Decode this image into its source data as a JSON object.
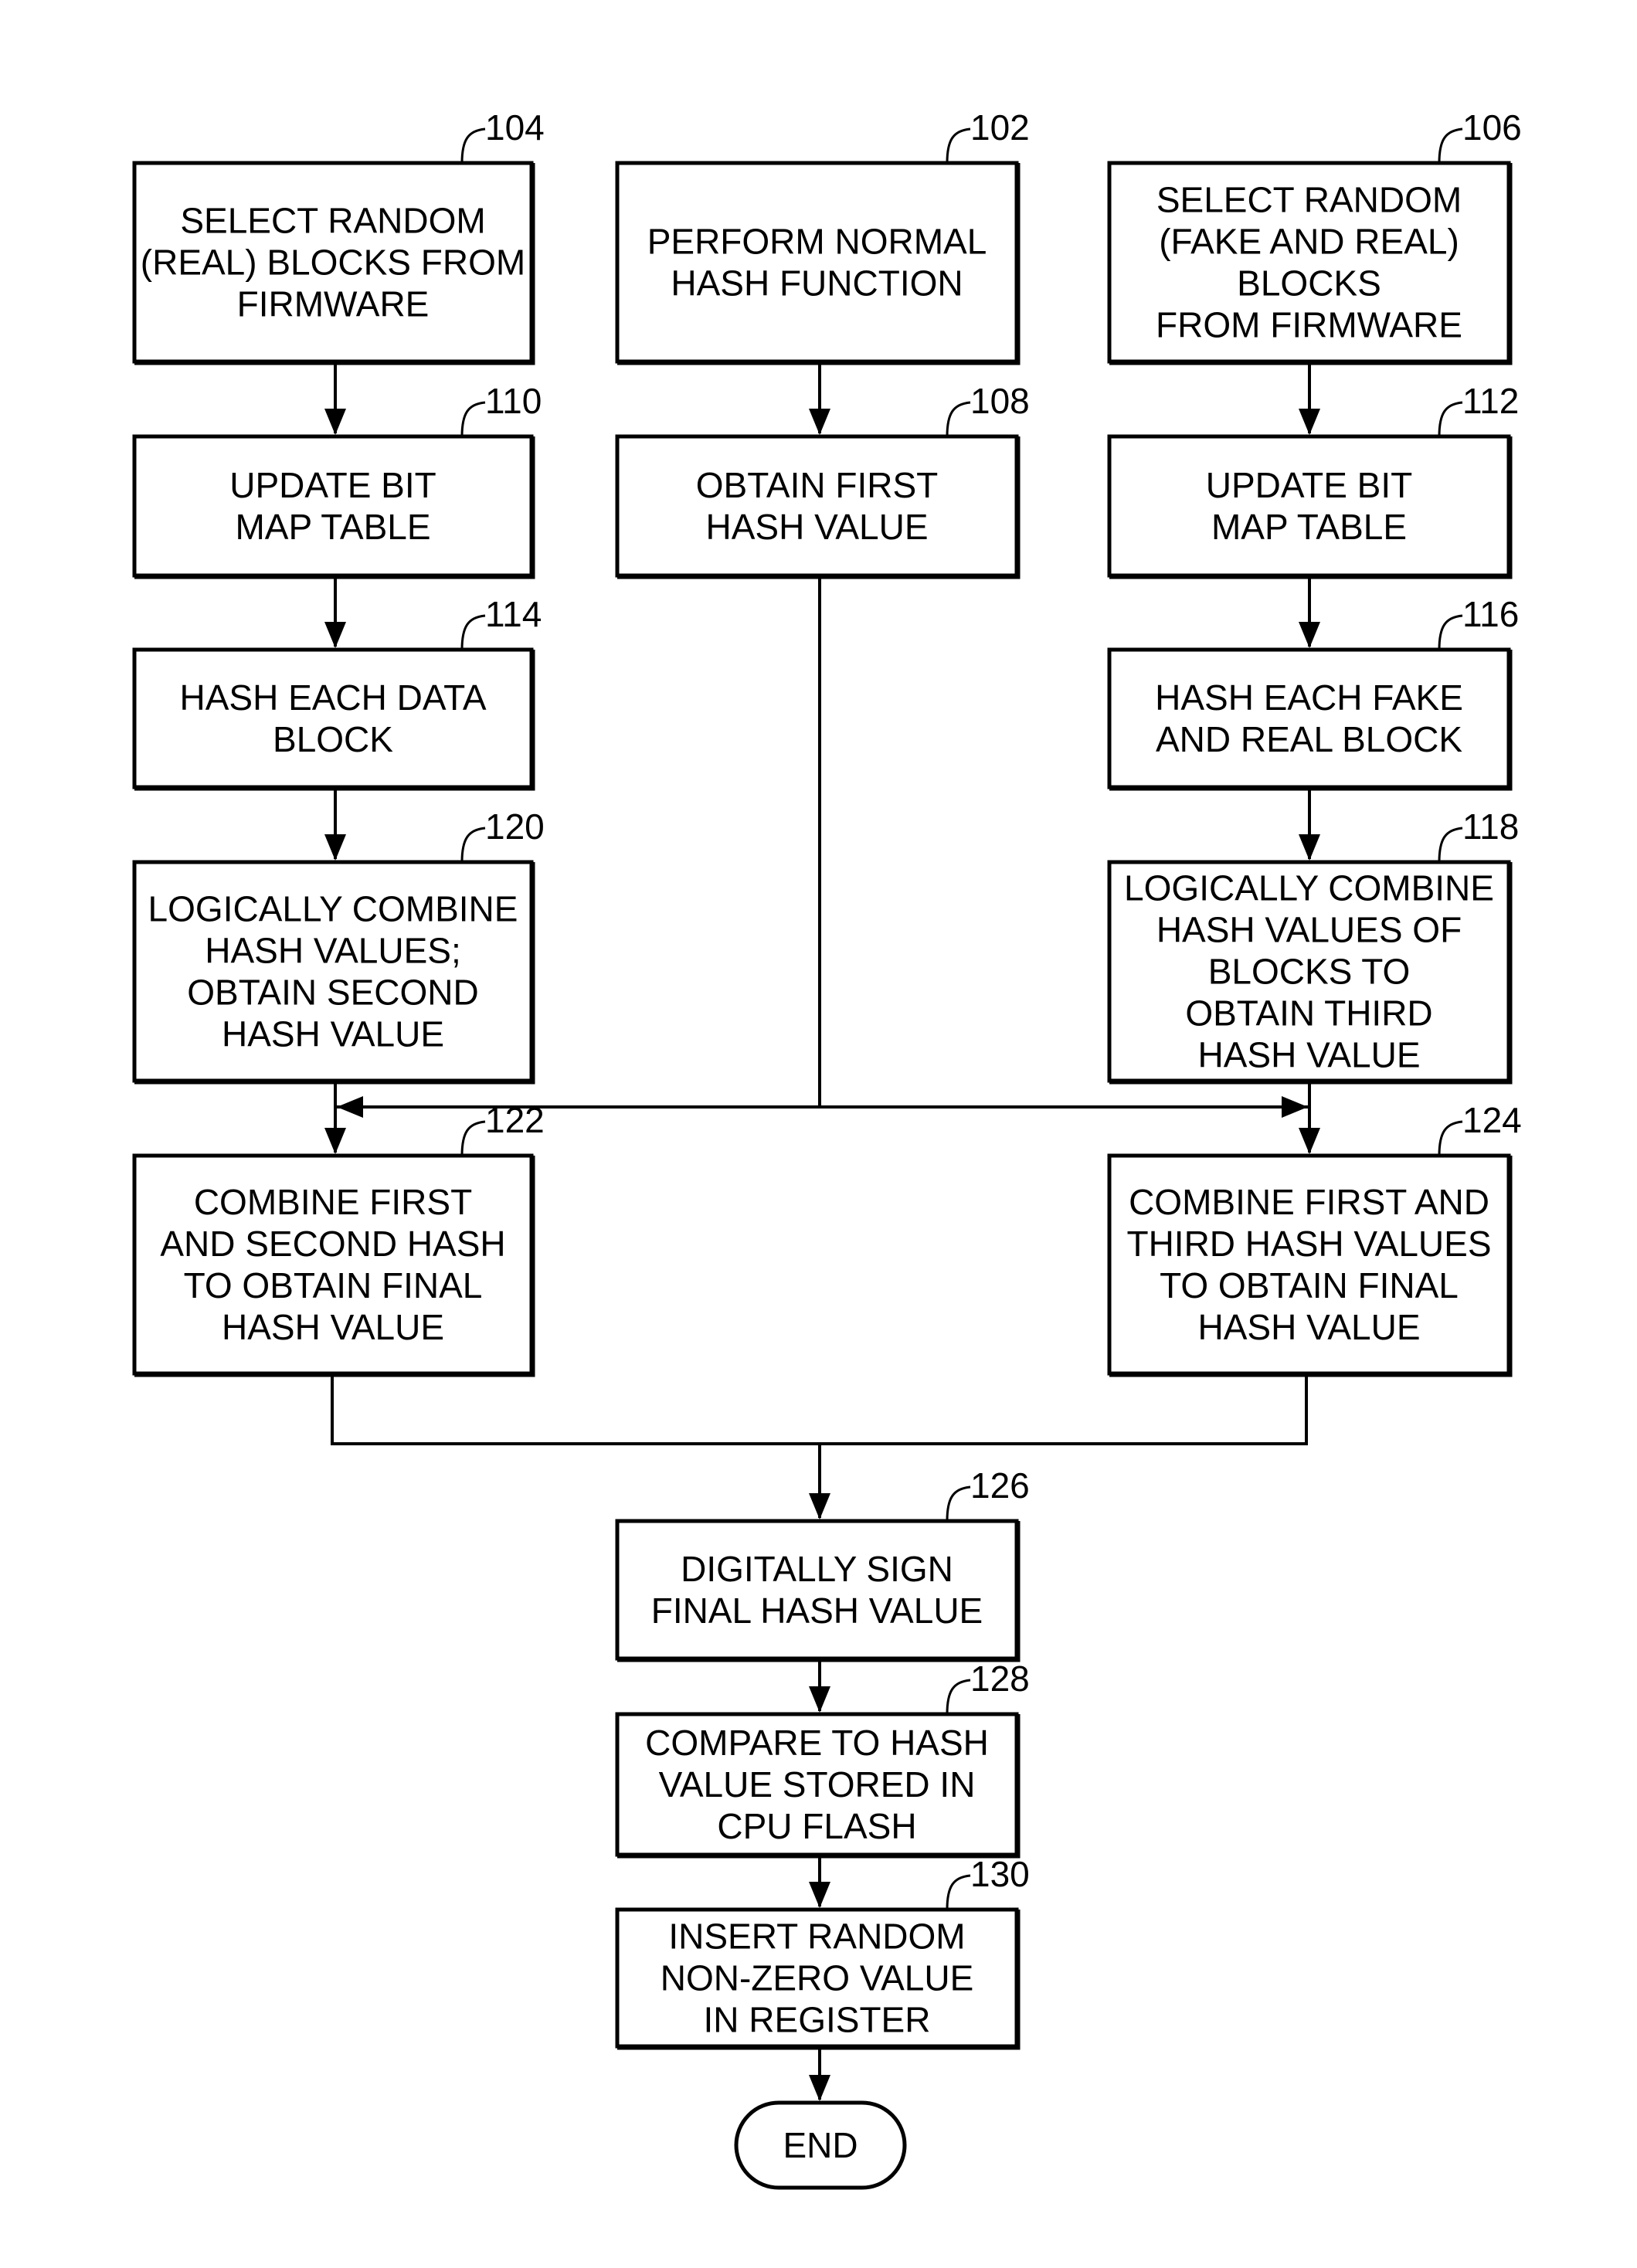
{
  "figure": {
    "type": "flowchart",
    "steps": [
      {
        "id": "104",
        "ref": "104",
        "lines": [
          "SELECT RANDOM",
          "(REAL) BLOCKS FROM",
          "FIRMWARE"
        ]
      },
      {
        "id": "102",
        "ref": "102",
        "lines": [
          "PERFORM NORMAL",
          "HASH FUNCTION"
        ]
      },
      {
        "id": "106",
        "ref": "106",
        "lines": [
          "SELECT RANDOM",
          "(FAKE AND REAL)",
          "BLOCKS",
          "FROM FIRMWARE"
        ]
      },
      {
        "id": "110",
        "ref": "110",
        "lines": [
          "UPDATE BIT",
          "MAP TABLE"
        ]
      },
      {
        "id": "108",
        "ref": "108",
        "lines": [
          "OBTAIN FIRST",
          "HASH VALUE"
        ]
      },
      {
        "id": "112",
        "ref": "112",
        "lines": [
          "UPDATE BIT",
          "MAP TABLE"
        ]
      },
      {
        "id": "114",
        "ref": "114",
        "lines": [
          "HASH EACH DATA",
          "BLOCK"
        ]
      },
      {
        "id": "116",
        "ref": "116",
        "lines": [
          "HASH EACH FAKE",
          "AND REAL BLOCK"
        ]
      },
      {
        "id": "120",
        "ref": "120",
        "lines": [
          "LOGICALLY COMBINE",
          "HASH VALUES;",
          "OBTAIN SECOND",
          "HASH VALUE"
        ]
      },
      {
        "id": "118",
        "ref": "118",
        "lines": [
          "LOGICALLY COMBINE",
          "HASH VALUES OF",
          "BLOCKS TO",
          "OBTAIN THIRD",
          "HASH VALUE"
        ]
      },
      {
        "id": "122",
        "ref": "122",
        "lines": [
          "COMBINE FIRST",
          "AND SECOND HASH",
          "TO OBTAIN FINAL",
          "HASH VALUE"
        ]
      },
      {
        "id": "124",
        "ref": "124",
        "lines": [
          "COMBINE FIRST AND",
          "THIRD HASH VALUES",
          "TO OBTAIN FINAL",
          "HASH VALUE"
        ]
      },
      {
        "id": "126",
        "ref": "126",
        "lines": [
          "DIGITALLY SIGN",
          "FINAL HASH VALUE"
        ]
      },
      {
        "id": "128",
        "ref": "128",
        "lines": [
          "COMPARE TO HASH",
          "VALUE STORED IN",
          "CPU FLASH"
        ]
      },
      {
        "id": "130",
        "ref": "130",
        "lines": [
          "INSERT RANDOM",
          "NON-ZERO VALUE",
          "IN REGISTER"
        ]
      }
    ],
    "terminal": {
      "label": "END"
    },
    "edges": [
      [
        "104",
        "110"
      ],
      [
        "110",
        "114"
      ],
      [
        "114",
        "120"
      ],
      [
        "120",
        "122"
      ],
      [
        "102",
        "108"
      ],
      [
        "108",
        "122"
      ],
      [
        "108",
        "124"
      ],
      [
        "106",
        "112"
      ],
      [
        "112",
        "116"
      ],
      [
        "116",
        "118"
      ],
      [
        "118",
        "124"
      ],
      [
        "122",
        "126"
      ],
      [
        "124",
        "126"
      ],
      [
        "126",
        "128"
      ],
      [
        "128",
        "130"
      ],
      [
        "130",
        "END"
      ]
    ]
  }
}
